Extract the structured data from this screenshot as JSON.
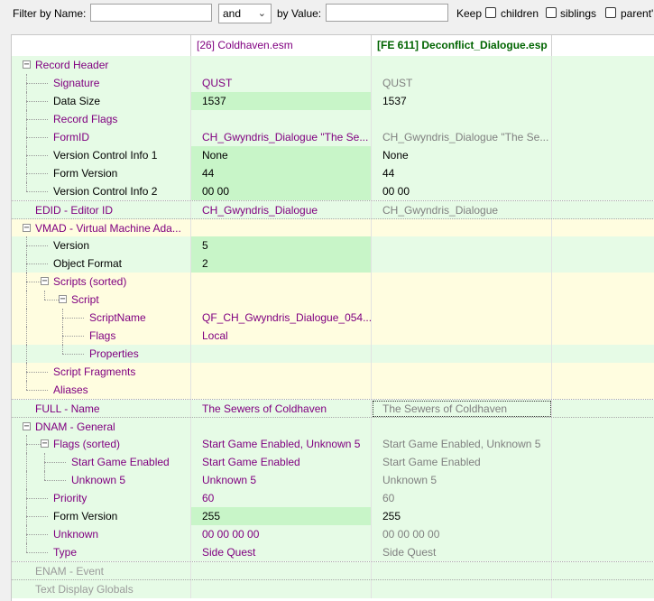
{
  "filter": {
    "by_name_label": "Filter by Name:",
    "name_value": "",
    "operator": "and",
    "by_value_label": "by Value:",
    "value_value": "",
    "keep_label": "Keep",
    "children_label": "children",
    "siblings_label": "siblings",
    "parents_label": "parent'"
  },
  "columns": {
    "name": "",
    "plugin1": "[26] Coldhaven.esm",
    "plugin2": "[FE 611] Deconflict_Dialogue.esp",
    "extra": ""
  },
  "colors": {
    "green_row": "#e3fbe3",
    "green_value": "#c8f5c8",
    "yellow_row": "#fffde0",
    "purple_text": "#800080",
    "grey_text": "#808080",
    "header_green": "#006400"
  },
  "rows": [
    {
      "label": "Record Header",
      "depth": 0,
      "expander": "minus",
      "v1": "",
      "v2": "",
      "name_color": "#800080",
      "v1_color": "#800080",
      "v2_color": "#808080",
      "bg": "#e6fbe6",
      "v1bg": "#e6fbe6"
    },
    {
      "label": "Signature",
      "depth": 1,
      "v1": "QUST",
      "v2": "QUST",
      "name_color": "#800080",
      "v1_color": "#800080",
      "v2_color": "#808080",
      "bg": "#e6fbe6",
      "v1bg": "#e6fbe6"
    },
    {
      "label": "Data Size",
      "depth": 1,
      "v1": "1537",
      "v2": "1537",
      "name_color": "#000000",
      "v1_color": "#000000",
      "v2_color": "#000000",
      "bg": "#e6fbe6",
      "v1bg": "#c8f5c8"
    },
    {
      "label": "Record Flags",
      "depth": 1,
      "v1": "",
      "v2": "",
      "name_color": "#800080",
      "v1_color": "#800080",
      "v2_color": "#808080",
      "bg": "#e6fbe6",
      "v1bg": "#e6fbe6"
    },
    {
      "label": "FormID",
      "depth": 1,
      "v1": "CH_Gwyndris_Dialogue \"The Se...",
      "v2": "CH_Gwyndris_Dialogue \"The Se...",
      "name_color": "#800080",
      "v1_color": "#800080",
      "v2_color": "#808080",
      "bg": "#e6fbe6",
      "v1bg": "#e6fbe6"
    },
    {
      "label": "Version Control Info 1",
      "depth": 1,
      "v1": "None",
      "v2": "None",
      "name_color": "#000000",
      "v1_color": "#000000",
      "v2_color": "#000000",
      "bg": "#e6fbe6",
      "v1bg": "#c8f5c8"
    },
    {
      "label": "Form Version",
      "depth": 1,
      "v1": "44",
      "v2": "44",
      "name_color": "#000000",
      "v1_color": "#000000",
      "v2_color": "#000000",
      "bg": "#e6fbe6",
      "v1bg": "#c8f5c8"
    },
    {
      "label": "Version Control Info 2",
      "depth": 1,
      "last": true,
      "v1": "00 00",
      "v2": "00 00",
      "name_color": "#000000",
      "v1_color": "#000000",
      "v2_color": "#000000",
      "bg": "#e6fbe6",
      "v1bg": "#c8f5c8"
    },
    {
      "label": "EDID - Editor ID",
      "depth": 0,
      "v1": "CH_Gwyndris_Dialogue",
      "v2": "CH_Gwyndris_Dialogue",
      "name_color": "#800080",
      "v1_color": "#800080",
      "v2_color": "#808080",
      "bg": "#e6fbe6",
      "v1bg": "#e6fbe6",
      "sep": true
    },
    {
      "label": "VMAD - Virtual Machine Ada...",
      "depth": 0,
      "expander": "minus",
      "v1": "",
      "v2": "",
      "name_color": "#800080",
      "v1_color": "#800080",
      "v2_color": "#808080",
      "bg": "#fffde0",
      "v1bg": "#fffde0",
      "sep": true
    },
    {
      "label": "Version",
      "depth": 1,
      "v1": "5",
      "v2": "",
      "name_color": "#000000",
      "v1_color": "#000000",
      "v2_color": "#000000",
      "bg": "#e6fbe6",
      "v1bg": "#c8f5c8"
    },
    {
      "label": "Object Format",
      "depth": 1,
      "v1": "2",
      "v2": "",
      "name_color": "#000000",
      "v1_color": "#000000",
      "v2_color": "#000000",
      "bg": "#e6fbe6",
      "v1bg": "#c8f5c8"
    },
    {
      "label": "Scripts (sorted)",
      "depth": 1,
      "expander": "minus",
      "v1": "",
      "v2": "",
      "name_color": "#800080",
      "v1_color": "#800080",
      "v2_color": "#808080",
      "bg": "#fffde0",
      "v1bg": "#fffde0"
    },
    {
      "label": "Script",
      "depth": 2,
      "expander": "minus",
      "v1": "",
      "v2": "",
      "name_color": "#800080",
      "v1_color": "#800080",
      "v2_color": "#808080",
      "bg": "#fffde0",
      "v1bg": "#fffde0"
    },
    {
      "label": "ScriptName",
      "depth": 3,
      "v1": "QF_CH_Gwyndris_Dialogue_054...",
      "v2": "",
      "name_color": "#800080",
      "v1_color": "#800080",
      "v2_color": "#808080",
      "bg": "#fffde0",
      "v1bg": "#fffde0"
    },
    {
      "label": "Flags",
      "depth": 3,
      "v1": "Local",
      "v2": "",
      "name_color": "#800080",
      "v1_color": "#800080",
      "v2_color": "#808080",
      "bg": "#fffde0",
      "v1bg": "#fffde0"
    },
    {
      "label": "Properties",
      "depth": 3,
      "last": true,
      "v1": "",
      "v2": "",
      "name_color": "#800080",
      "v1_color": "#800080",
      "v2_color": "#808080",
      "bg": "#e6fbe6",
      "v1bg": "#e6fbe6"
    },
    {
      "label": "Script Fragments",
      "depth": 1,
      "v1": "",
      "v2": "",
      "name_color": "#800080",
      "v1_color": "#800080",
      "v2_color": "#808080",
      "bg": "#fffde0",
      "v1bg": "#fffde0"
    },
    {
      "label": "Aliases",
      "depth": 1,
      "last": true,
      "v1": "",
      "v2": "",
      "name_color": "#800080",
      "v1_color": "#800080",
      "v2_color": "#808080",
      "bg": "#fffde0",
      "v1bg": "#fffde0"
    },
    {
      "label": "FULL - Name",
      "depth": 0,
      "v1": "The Sewers of Coldhaven",
      "v2": "The Sewers of Coldhaven",
      "name_color": "#800080",
      "v1_color": "#800080",
      "v2_color": "#808080",
      "bg": "#e6fbe6",
      "v1bg": "#e6fbe6",
      "sep": true,
      "focus2": true
    },
    {
      "label": "DNAM - General",
      "depth": 0,
      "expander": "minus",
      "v1": "",
      "v2": "",
      "name_color": "#800080",
      "v1_color": "#800080",
      "v2_color": "#808080",
      "bg": "#e6fbe6",
      "v1bg": "#e6fbe6",
      "sep": true
    },
    {
      "label": "Flags (sorted)",
      "depth": 1,
      "expander": "minus",
      "v1": "Start Game Enabled, Unknown 5",
      "v2": "Start Game Enabled, Unknown 5",
      "name_color": "#800080",
      "v1_color": "#800080",
      "v2_color": "#808080",
      "bg": "#e6fbe6",
      "v1bg": "#e6fbe6"
    },
    {
      "label": "Start Game Enabled",
      "depth": 2,
      "v1": "Start Game Enabled",
      "v2": "Start Game Enabled",
      "name_color": "#800080",
      "v1_color": "#800080",
      "v2_color": "#808080",
      "bg": "#e6fbe6",
      "v1bg": "#e6fbe6"
    },
    {
      "label": "Unknown 5",
      "depth": 2,
      "last": true,
      "v1": "Unknown 5",
      "v2": "Unknown 5",
      "name_color": "#800080",
      "v1_color": "#800080",
      "v2_color": "#808080",
      "bg": "#e6fbe6",
      "v1bg": "#e6fbe6"
    },
    {
      "label": "Priority",
      "depth": 1,
      "v1": "60",
      "v2": "60",
      "name_color": "#800080",
      "v1_color": "#800080",
      "v2_color": "#808080",
      "bg": "#e6fbe6",
      "v1bg": "#e6fbe6"
    },
    {
      "label": "Form Version",
      "depth": 1,
      "v1": "255",
      "v2": "255",
      "name_color": "#000000",
      "v1_color": "#000000",
      "v2_color": "#000000",
      "bg": "#e6fbe6",
      "v1bg": "#c8f5c8"
    },
    {
      "label": "Unknown",
      "depth": 1,
      "v1": "00 00 00 00",
      "v2": "00 00 00 00",
      "name_color": "#800080",
      "v1_color": "#800080",
      "v2_color": "#808080",
      "bg": "#e6fbe6",
      "v1bg": "#e6fbe6"
    },
    {
      "label": "Type",
      "depth": 1,
      "last": true,
      "v1": "Side Quest",
      "v2": "Side Quest",
      "name_color": "#800080",
      "v1_color": "#800080",
      "v2_color": "#808080",
      "bg": "#e6fbe6",
      "v1bg": "#e6fbe6"
    },
    {
      "label": "ENAM - Event",
      "depth": 0,
      "v1": "",
      "v2": "",
      "name_color": "#9a9a9a",
      "v1_color": "#808080",
      "v2_color": "#808080",
      "bg": "#e6fbe6",
      "v1bg": "#e6fbe6",
      "sep": true
    },
    {
      "label": "Text Display Globals",
      "depth": 0,
      "v1": "",
      "v2": "",
      "name_color": "#9a9a9a",
      "v1_color": "#808080",
      "v2_color": "#808080",
      "bg": "#e6fbe6",
      "v1bg": "#e6fbe6",
      "sep": true
    }
  ]
}
